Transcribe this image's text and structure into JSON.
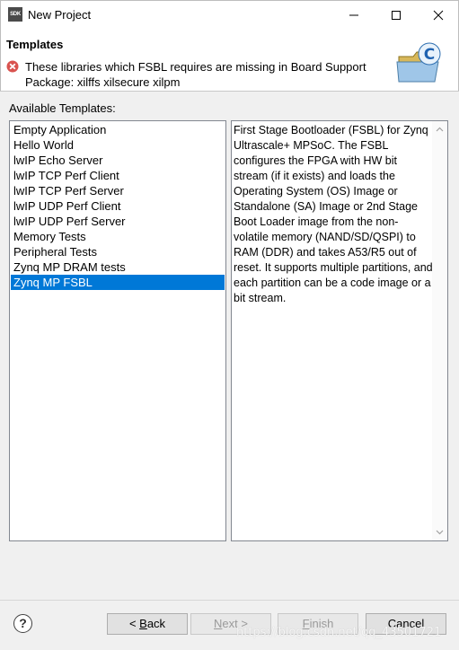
{
  "window": {
    "app_icon_text": "SDK",
    "title": "New Project"
  },
  "header": {
    "title": "Templates",
    "error_message": "These libraries which FSBL requires are missing in Board Support Package: xilffs xilsecure xilpm"
  },
  "templates": {
    "label": "Available Templates:",
    "items": [
      "Empty Application",
      "Hello World",
      "lwIP Echo Server",
      "lwIP TCP Perf Client",
      "lwIP TCP Perf Server",
      "lwIP UDP Perf Client",
      "lwIP UDP Perf Server",
      "Memory Tests",
      "Peripheral Tests",
      "Zynq MP DRAM tests",
      "Zynq MP FSBL"
    ],
    "selected": "Zynq MP FSBL"
  },
  "description": "First Stage Bootloader (FSBL) for Zynq Ultrascale+ MPSoC. The FSBL configures the FPGA with HW bit stream (if it exists)  and loads the Operating System (OS) Image or Standalone (SA) Image or 2nd Stage Boot Loader image from the non-volatile memory (NAND/SD/QSPI) to RAM (DDR) and takes A53/R5 out of reset.  It supports multiple partitions,  and each partition can be a code image or a bit stream.",
  "buttons": {
    "help": "?",
    "back_prefix": "< ",
    "back_accel": "B",
    "back_rest": "ack",
    "next_accel": "N",
    "next_rest": "ext >",
    "finish_accel": "F",
    "finish_rest": "inish",
    "cancel": "Cancel"
  },
  "watermark": "https://blog.csdn.net/qq_43501721",
  "colors": {
    "selection": "#0078d7",
    "error": "#d9534f"
  }
}
